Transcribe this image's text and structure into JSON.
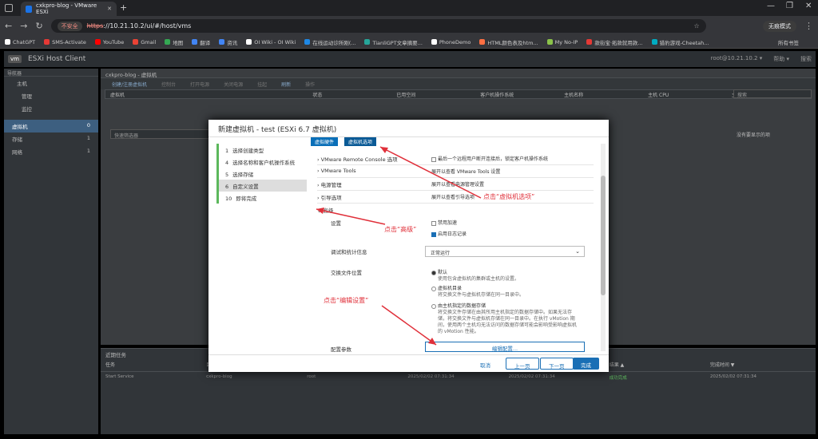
{
  "browser": {
    "tab_title": "cxkpro-blog - VMware ESXi",
    "tab_close": "✕",
    "new_tab": "+",
    "insecure_label": "不安全",
    "url_scheme": "https",
    "url_rest": "://10.21.10.2/ui/#/host/vms",
    "incognito_label": "无痕模式",
    "win_min": "—",
    "win_restore": "❐",
    "win_close": "✕"
  },
  "bookmarks": [
    {
      "label": "ChatGPT",
      "color": "#ffffff"
    },
    {
      "label": "SMS-Activate",
      "color": "#e53935"
    },
    {
      "label": "YouTube",
      "color": "#ff0000"
    },
    {
      "label": "Gmail",
      "color": "#ea4335"
    },
    {
      "label": "地图",
      "color": "#34a853"
    },
    {
      "label": "翻译",
      "color": "#4285f4"
    },
    {
      "label": "资讯",
      "color": "#4285f4"
    },
    {
      "label": "OI Wiki - OI Wiki",
      "color": "#ffffff"
    },
    {
      "label": "在线运动诊所刚(...",
      "color": "#1e88e5"
    },
    {
      "label": "TianliGPT文章摘要...",
      "color": "#26a69a"
    },
    {
      "label": "PhoneDemo",
      "color": "#ffffff"
    },
    {
      "label": "HTML颜色表及htm...",
      "color": "#ff7043"
    },
    {
      "label": "My No-IP",
      "color": "#8bc34a"
    },
    {
      "label": "款街宝·拓款就用款...",
      "color": "#e53935"
    },
    {
      "label": "猎豹游戏-Cheetah...",
      "color": "#00acc1"
    }
  ],
  "bookmarks_all": "所有书签",
  "esxi": {
    "logo": "vm",
    "title": "ESXi Host Client",
    "user": "root@10.21.10.2 ▾",
    "help": "帮助 ▾",
    "search": "搜索"
  },
  "navigator": {
    "header": "导航器",
    "host": "主机",
    "manage": "管理",
    "monitor": "监控",
    "vms": "虚拟机",
    "vms_count": "0",
    "storage": "存储",
    "storage_count": "1",
    "network": "网络",
    "network_count": "1"
  },
  "main": {
    "breadcrumb": "cxkpro-blog - 虚拟机",
    "toolbar": [
      "创建/注册虚拟机",
      "控制台",
      "打开电源",
      "关闭电源",
      "挂起",
      "刷新",
      "操作"
    ],
    "search_placeholder": "搜索",
    "columns": [
      "虚拟机",
      "状态",
      "已用空间",
      "客户机操作系统",
      "主机名称",
      "主机 CPU",
      "主机内存"
    ],
    "filter_placeholder": "快速筛选器",
    "no_data": "没有要显示的项"
  },
  "recent": {
    "title": "近期任务",
    "columns": [
      "任务",
      "目标",
      "启动者",
      "已排队时间",
      "启动时间",
      "结果 ▲",
      "完成时间 ▼"
    ],
    "row": [
      "Start Service",
      "cxkpro-blog",
      "root",
      "2025/02/02 07:31:34",
      "2025/02/02 07:31:34",
      "成功完成",
      "2025/02/02 07:31:34"
    ]
  },
  "dialog": {
    "title": "新建虚拟机 - test (ESXi 6.7 虚拟机)",
    "steps": [
      {
        "num": "1",
        "label": "选择创建类型"
      },
      {
        "num": "4",
        "label": "选择名称和客户机操作系统"
      },
      {
        "num": "5",
        "label": "选择存储"
      },
      {
        "num": "6",
        "label": "自定义设置"
      },
      {
        "num": "10",
        "label": "即将完成"
      }
    ],
    "tab_hw": "虚拟硬件",
    "tab_opts": "虚拟机选项",
    "rows": {
      "vmrc_label": "VMware Remote Console 选项",
      "vmrc_value": "最后一个远程用户断开连接后，锁定客户机操作系统",
      "tools_label": "VMware Tools",
      "tools_value": "展开以查看 VMware Tools 设置",
      "power_label": "电源管理",
      "power_value": "展开以查看电源管理设置",
      "boot_label": "引导选项",
      "boot_value": "展开以查看引导选项",
      "advanced_label": "高级",
      "settings_label": "设置",
      "accel_label": "禁用加速",
      "logging_label": "启用日志记录",
      "debug_label": "调试和统计信息",
      "debug_value": "正常运行",
      "swap_label": "交换文件位置",
      "swap_default": "默认",
      "swap_default_desc": "使用包含虚拟机的集群或主机的设置。",
      "swap_vmdir": "虚拟机目录",
      "swap_vmdir_desc": "将交换文件与虚拟机存储在同一目录中。",
      "swap_host": "由主机指定的数据存储",
      "swap_host_desc": [
        "将交换文件存储在由其所用主机指定的数据存储中。如果无法存",
        "储，将交换文件与虚拟机存储在同一目录中。在执行 vMotion 期",
        "间，使用两个主机均无法访问的数据存储可能会影响受影响虚拟机",
        "的 vMotion 性能。"
      ],
      "config_label": "配置参数",
      "edit_config": "编辑配置..."
    },
    "cancel": "取消",
    "back": "上一页",
    "next": "下一页",
    "finish": "完成"
  },
  "annotations": {
    "vm_options": "点击“虚拟机选项”",
    "advanced": "点击“高级”",
    "edit_settings": "点击“编辑设置”"
  },
  "colors": {
    "accent": "#1a6fb5",
    "annotation": "#e0303a",
    "step_done": "#5cb85c"
  }
}
